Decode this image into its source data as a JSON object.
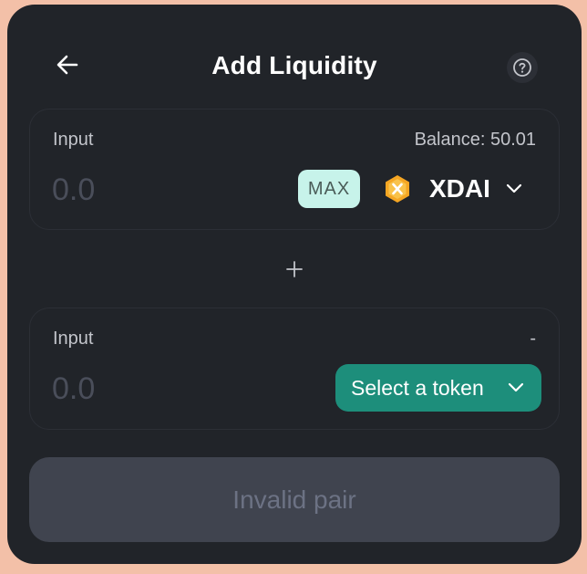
{
  "header": {
    "title": "Add Liquidity",
    "back_icon": "arrow-left-icon",
    "help_icon": "question-circle-icon"
  },
  "input_a": {
    "label": "Input",
    "balance": "Balance: 50.01",
    "amount_placeholder": "0.0",
    "max_label": "MAX",
    "token_symbol": "XDAI",
    "token_icon": "xdai-token-icon",
    "chevron_icon": "chevron-down-icon"
  },
  "plus_icon": "plus-icon",
  "input_b": {
    "label": "Input",
    "balance": "-",
    "amount_placeholder": "0.0",
    "select_label": "Select a token",
    "chevron_icon": "chevron-down-icon"
  },
  "submit": {
    "label": "Invalid pair"
  },
  "colors": {
    "page_background": "#f3c0a8",
    "card_background": "#212429",
    "accent_teal": "#1d8e7b",
    "max_background": "#c7f3ea",
    "token_icon_orange": "#f5a623",
    "disabled_button": "#40444f"
  }
}
